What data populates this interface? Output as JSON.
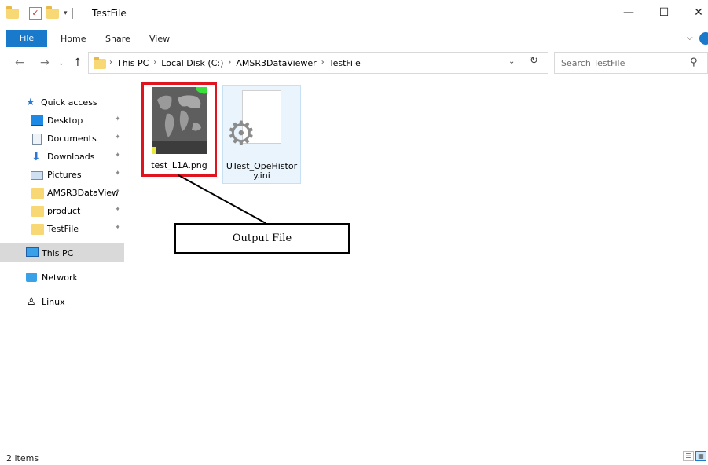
{
  "window": {
    "title": "TestFile",
    "minimize": "—",
    "maximize": "☐",
    "close": "✕"
  },
  "ribbon": {
    "tabs": [
      "File",
      "Home",
      "Share",
      "View"
    ]
  },
  "address": {
    "crumbs": [
      "This PC",
      "Local Disk (C:)",
      "AMSR3DataViewer",
      "TestFile"
    ],
    "separator": "›"
  },
  "search": {
    "placeholder": "Search TestFile"
  },
  "nav": {
    "quick_access": "Quick access",
    "pinned": [
      {
        "label": "Desktop"
      },
      {
        "label": "Documents"
      },
      {
        "label": "Downloads"
      },
      {
        "label": "Pictures"
      },
      {
        "label": "AMSR3DataView"
      },
      {
        "label": "product"
      },
      {
        "label": "TestFile"
      }
    ],
    "this_pc": "This PC",
    "network": "Network",
    "linux": "Linux"
  },
  "files": [
    {
      "name": "test_L1A.png"
    },
    {
      "name_line1": "UTest_OpeHistor",
      "name_line2": "y.ini"
    }
  ],
  "callout": {
    "text": "Output File"
  },
  "status": {
    "items": "2 items"
  },
  "colors": {
    "accent": "#1979ca",
    "highlight": "#e0141e"
  }
}
